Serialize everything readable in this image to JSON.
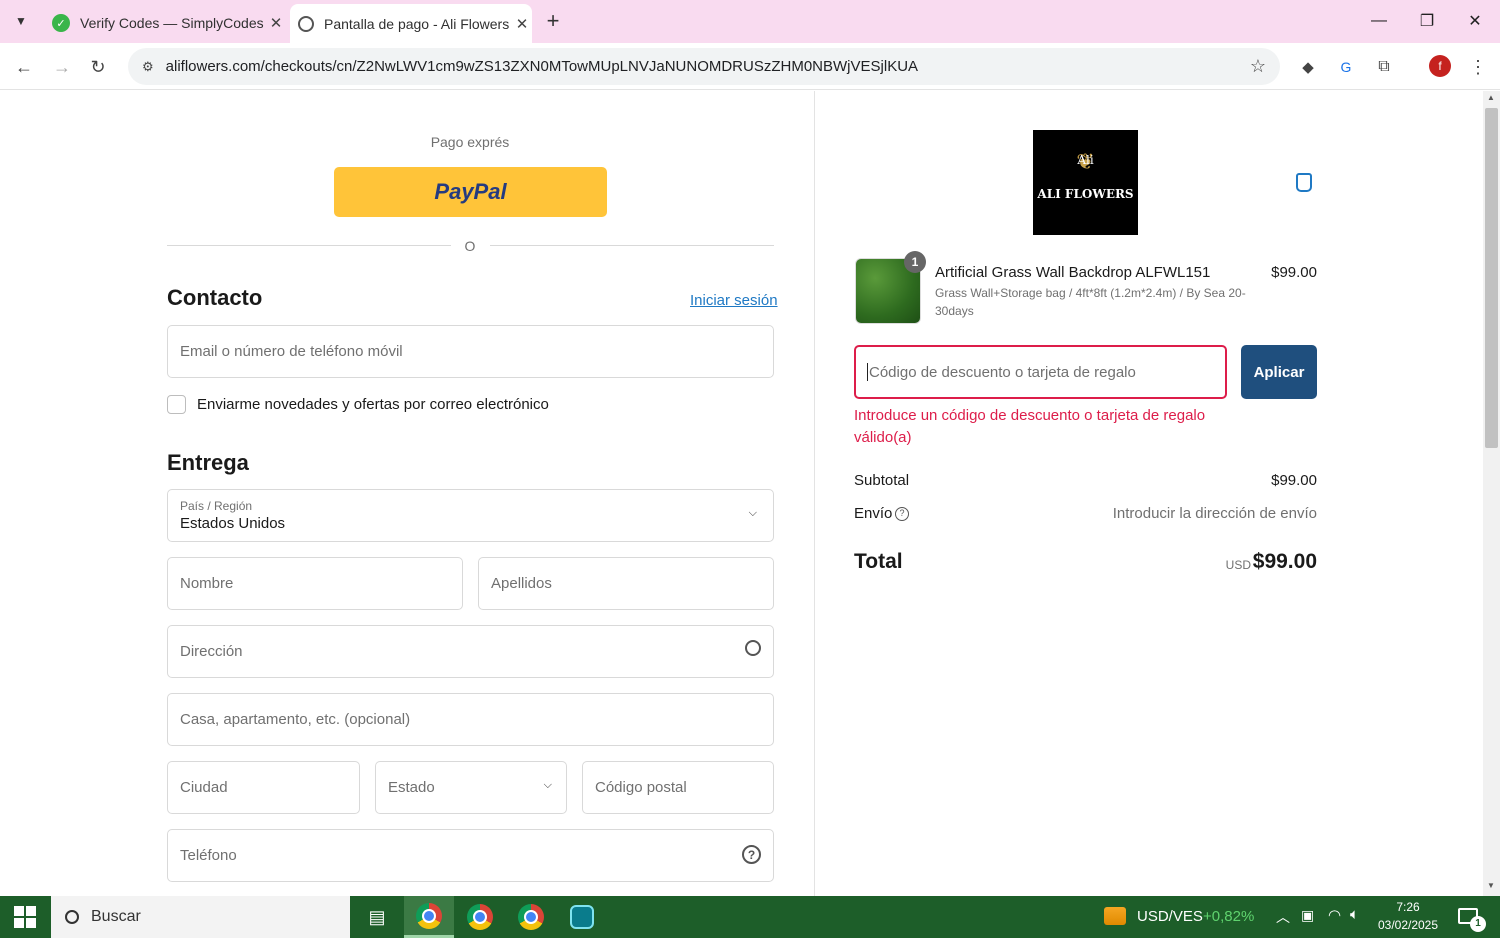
{
  "browser": {
    "tabs": [
      {
        "title": "Verify Codes — SimplyCodes"
      },
      {
        "title": "Pantalla de pago - Ali Flowers"
      }
    ],
    "url": "aliflowers.com/checkouts/cn/Z2NwLWV1cm9wZS13ZXN0MTowMUpLNVJaNUNOMDRUSzZHM0NBWjVESjlKUA",
    "profile_initial": "f"
  },
  "checkout": {
    "express_label": "Pago exprés",
    "paypal_label": "PayPal",
    "divider_or": "O",
    "contact": {
      "heading": "Contacto",
      "login_link": "Iniciar sesión",
      "email_placeholder": "Email o número de teléfono móvil",
      "newsletter_label": "Enviarme novedades y ofertas por correo electrónico"
    },
    "delivery": {
      "heading": "Entrega",
      "country_label": "País / Región",
      "country_value": "Estados Unidos",
      "first_name": "Nombre",
      "last_name": "Apellidos",
      "address": "Dirección",
      "apartment": "Casa, apartamento, etc. (opcional)",
      "city": "Ciudad",
      "state": "Estado",
      "zip": "Código postal",
      "phone": "Teléfono"
    }
  },
  "summary": {
    "brand_line1": "Ali",
    "brand_line2": "ALI FLOWERS",
    "item": {
      "qty_badge": "1",
      "name": "Artificial Grass Wall Backdrop ALFWL151",
      "variant_line1": "Grass Wall+Storage bag / 4ft*8ft (1.2m*2.4m) / By Sea 20-",
      "variant_line2": "30days",
      "price": "$99.00"
    },
    "discount_placeholder": "Código de descuento o tarjeta de regalo",
    "apply_label": "Aplicar",
    "error_line1": "Introduce un código de descuento o tarjeta de regalo",
    "error_line2": "válido(a)",
    "subtotal_label": "Subtotal",
    "subtotal_value": "$99.00",
    "shipping_label": "Envío",
    "shipping_value": "Introducir la dirección de envío",
    "total_label": "Total",
    "currency": "USD",
    "total_value": "$99.00"
  },
  "taskbar": {
    "search_label": "Buscar",
    "ticker_pair": "USD/VES",
    "ticker_change": "+0,82%",
    "time": "7:26",
    "date": "03/02/2025",
    "notification_count": "1"
  },
  "colors": {
    "tabstrip": "#f9dbf0",
    "paypal_yellow": "#ffc439",
    "apply_button": "#1f4f7e",
    "error": "#dd1d4a",
    "link": "#1f79c4",
    "taskbar": "#1d5e29"
  }
}
